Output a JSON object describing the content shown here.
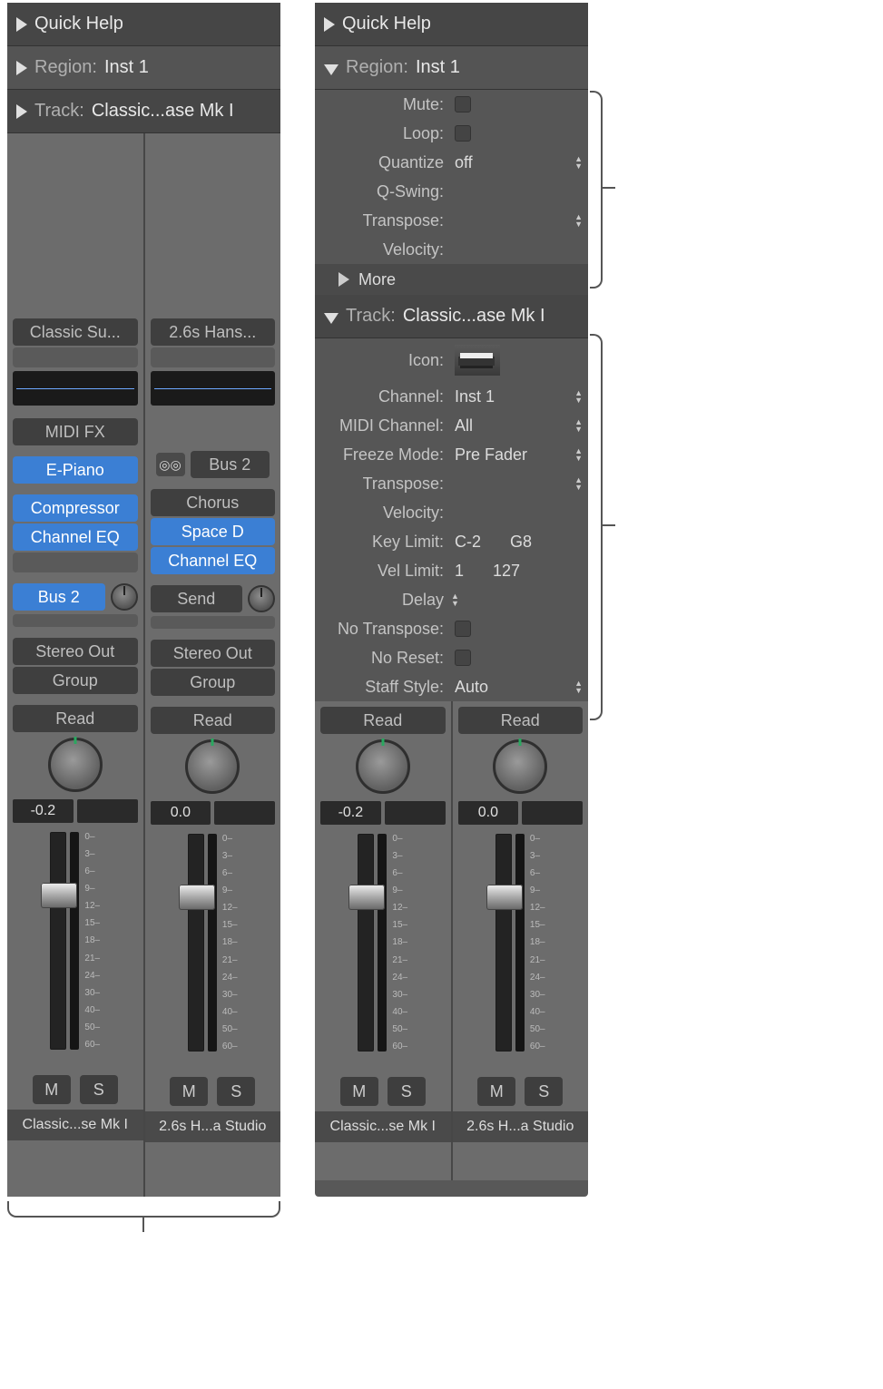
{
  "headers": {
    "quick_help": "Quick Help",
    "region_label": "Region:",
    "region_value": "Inst 1",
    "track_label": "Track:",
    "track_value": "Classic...ase Mk I"
  },
  "region_params": {
    "mute": "Mute:",
    "loop": "Loop:",
    "quantize": "Quantize",
    "quantize_value": "off",
    "qswing": "Q-Swing:",
    "transpose": "Transpose:",
    "velocity": "Velocity:",
    "more": "More"
  },
  "track_params": {
    "icon": "Icon:",
    "channel": "Channel:",
    "channel_value": "Inst 1",
    "midi_channel": "MIDI Channel:",
    "midi_channel_value": "All",
    "freeze_mode": "Freeze Mode:",
    "freeze_mode_value": "Pre Fader",
    "transpose": "Transpose:",
    "velocity": "Velocity:",
    "key_limit": "Key Limit:",
    "key_low": "C-2",
    "key_high": "G8",
    "vel_limit": "Vel Limit:",
    "vel_low": "1",
    "vel_high": "127",
    "delay": "Delay",
    "no_transpose": "No Transpose:",
    "no_reset": "No Reset:",
    "staff_style": "Staff Style:",
    "staff_style_value": "Auto"
  },
  "strips": {
    "a": {
      "preset": "Classic Su...",
      "midi_fx": "MIDI FX",
      "instrument": "E-Piano",
      "insert1": "Compressor",
      "insert2": "Channel EQ",
      "send": "Bus 2",
      "output": "Stereo Out",
      "group": "Group",
      "read": "Read",
      "db": "-0.2",
      "mute": "M",
      "solo": "S",
      "name": "Classic...se Mk I"
    },
    "b": {
      "preset": "2.6s Hans...",
      "io_icon": "⦾",
      "io_label": "Bus 2",
      "insert1": "Chorus",
      "insert2": "Space D",
      "insert3": "Channel EQ",
      "send": "Send",
      "output": "Stereo Out",
      "group": "Group",
      "read": "Read",
      "db": "0.0",
      "mute": "M",
      "solo": "S",
      "name": "2.6s H...a Studio"
    }
  },
  "fader_scale": [
    "0",
    "3",
    "6",
    "9",
    "12",
    "15",
    "18",
    "21",
    "24",
    "30",
    "40",
    "50",
    "60"
  ]
}
